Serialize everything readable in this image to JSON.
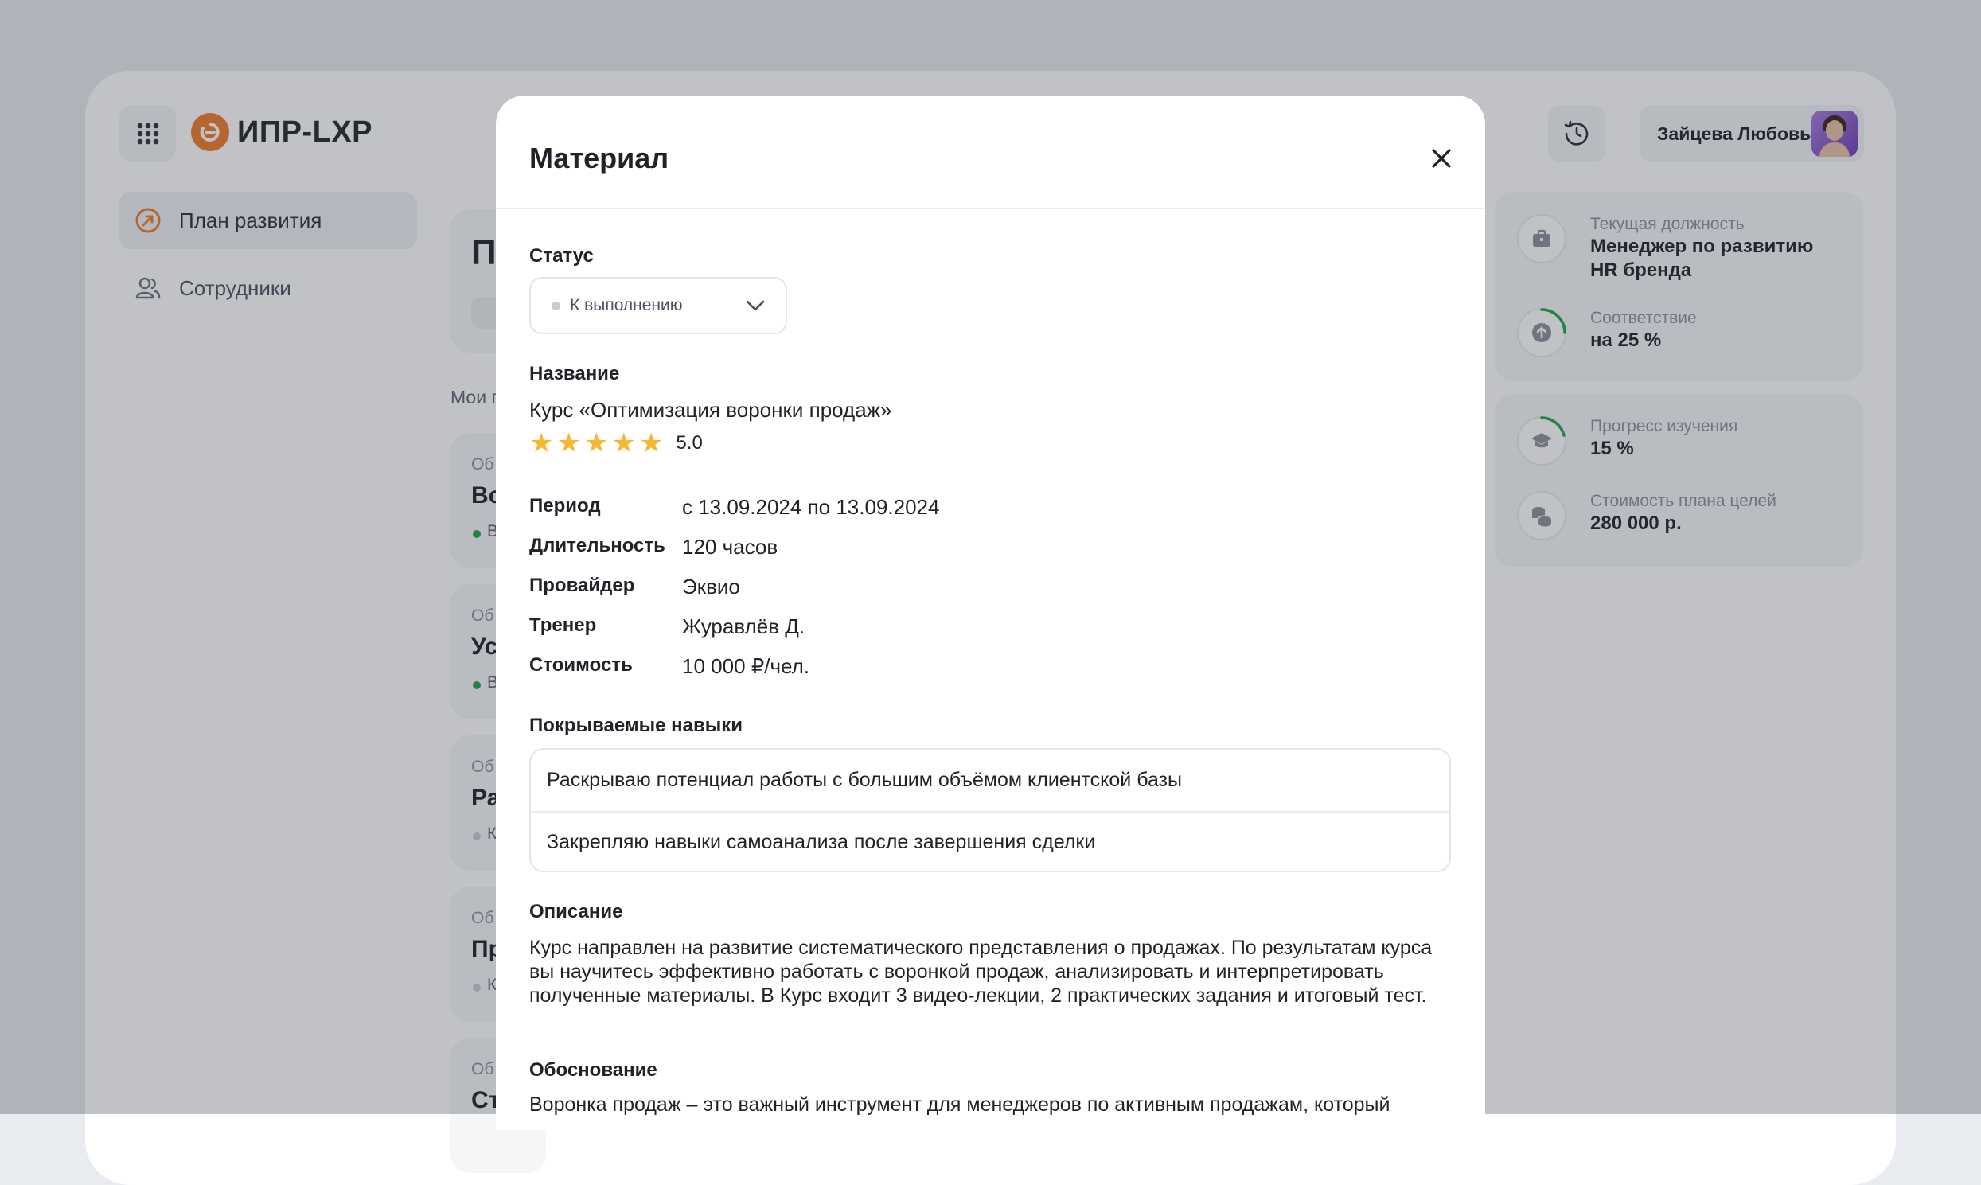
{
  "app": {
    "brand": "ИПР-LXP",
    "nav": [
      {
        "label": "План развития",
        "icon": "development-plan-icon",
        "active": true
      },
      {
        "label": "Сотрудники",
        "icon": "users-icon",
        "active": false
      }
    ],
    "user": {
      "name": "Зайцева Любовь"
    },
    "background_peek": {
      "page_title_initial": "П",
      "section_label": "Мои г",
      "cards": [
        {
          "type": "Об",
          "title": "Во",
          "status": "В"
        },
        {
          "type": "Об",
          "title": "Ус",
          "status": "В"
        },
        {
          "type": "Об",
          "title": "Ра",
          "status": "К"
        },
        {
          "type": "Об",
          "title": "Пр",
          "status": "К"
        },
        {
          "type": "Об",
          "title": "Ст",
          "status": ""
        }
      ]
    },
    "stats": [
      {
        "label": "Текущая должность",
        "value": "Менеджер по развитию HR бренда",
        "icon": "briefcase-icon"
      },
      {
        "label": "Соответствие",
        "value": "на 25 %",
        "icon": "arrow-up-circle-icon",
        "progress": 0.25
      },
      {
        "label": "Прогресс изучения",
        "value": "15 %",
        "icon": "graduation-cap-icon",
        "progress": 0.15
      },
      {
        "label": "Стоимость плана целей",
        "value": "280 000 р.",
        "icon": "coins-icon"
      }
    ]
  },
  "modal": {
    "title": "Материал",
    "status_label": "Статус",
    "status_value": "К выполнению",
    "name_label": "Название",
    "name_value": "Курс «Оптимизация воронки продаж»",
    "rating": "5.0",
    "info": [
      {
        "key": "Период",
        "value": "с 13.09.2024 по 13.09.2024"
      },
      {
        "key": "Длительность",
        "value": "120 часов"
      },
      {
        "key": "Провайдер",
        "value": "Эквио"
      },
      {
        "key": "Тренер",
        "value": "Журавлёв Д."
      },
      {
        "key": "Стоимость",
        "value": "10 000 ₽/чел."
      }
    ],
    "skills_label": "Покрываемые навыки",
    "skills": [
      "Раскрываю потенциал работы с большим объёмом клиентской базы",
      "Закрепляю навыки самоанализа после завершения сделки"
    ],
    "description_label": "Описание",
    "description": "Курс направлен на развитие систематического представления о продажах. По результатам курса вы научитесь эффективно работать с воронкой продаж, анализировать и интерпретировать полученные материалы. В Курс входит 3 видео-лекции, 2 практических задания и итоговый тест.",
    "justification_label": "Обоснование",
    "justification": "Воронка продаж – это важный инструмент для менеджеров по активным продажам, который"
  },
  "colors": {
    "accent": "#f07a2a",
    "progress": "#22a447",
    "star": "#f5b734"
  }
}
